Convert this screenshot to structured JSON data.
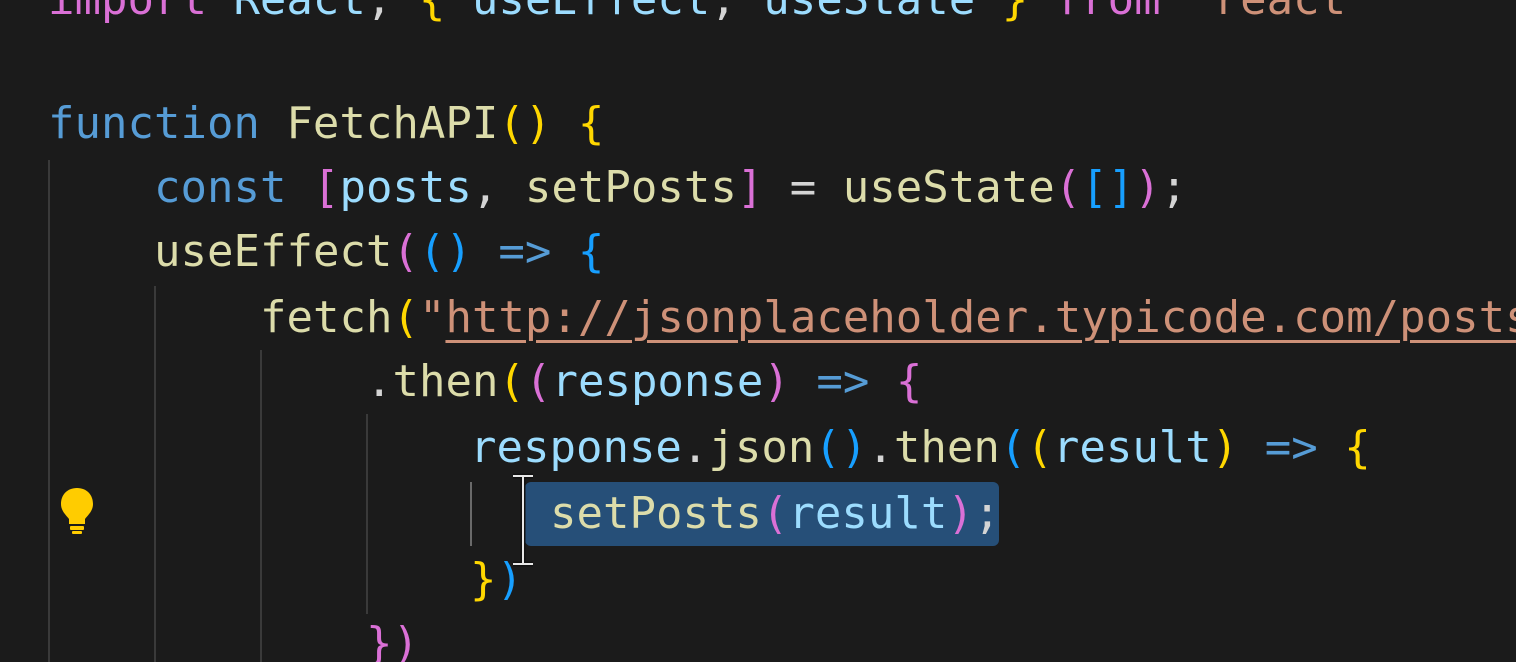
{
  "editor": {
    "theme": {
      "background": "#1b1b1b",
      "keyword": "#569cd6",
      "function": "#dcdcaa",
      "variable": "#9cdcfe",
      "string": "#ce9178",
      "bracket_level_1": "#ffd700",
      "bracket_level_2": "#da70d6",
      "bracket_level_3": "#179fff",
      "selection": "#264f78",
      "lightbulb": "#ffcc00"
    },
    "lines": [
      {
        "tokens": [
          {
            "t": "import",
            "c": "b2"
          },
          {
            "t": " React",
            "c": "var"
          },
          {
            "t": ", ",
            "c": "op"
          },
          {
            "t": "{",
            "c": "b1"
          },
          {
            "t": " useEffect",
            "c": "var"
          },
          {
            "t": ", ",
            "c": "op"
          },
          {
            "t": "useState",
            "c": "var"
          },
          {
            "t": " }",
            "c": "b1"
          },
          {
            "t": " from ",
            "c": "b2"
          },
          {
            "t": "\"react\"",
            "c": "str"
          }
        ]
      },
      {
        "tokens": []
      },
      {
        "tokens": [
          {
            "t": "function",
            "c": "kw"
          },
          {
            "t": " ",
            "c": "op"
          },
          {
            "t": "FetchAPI",
            "c": "fn"
          },
          {
            "t": "()",
            "c": "b1"
          },
          {
            "t": " ",
            "c": "op"
          },
          {
            "t": "{",
            "c": "b1"
          }
        ]
      },
      {
        "tokens": [
          {
            "t": "const",
            "c": "kw"
          },
          {
            "t": " ",
            "c": "op"
          },
          {
            "t": "[",
            "c": "b2"
          },
          {
            "t": "posts",
            "c": "var"
          },
          {
            "t": ", ",
            "c": "op"
          },
          {
            "t": "setPosts",
            "c": "fn"
          },
          {
            "t": "]",
            "c": "b2"
          },
          {
            "t": " = ",
            "c": "op"
          },
          {
            "t": "useState",
            "c": "fn"
          },
          {
            "t": "(",
            "c": "b2"
          },
          {
            "t": "[]",
            "c": "b3"
          },
          {
            "t": ")",
            "c": "b2"
          },
          {
            "t": ";",
            "c": "op"
          }
        ]
      },
      {
        "tokens": [
          {
            "t": "useEffect",
            "c": "fn"
          },
          {
            "t": "(",
            "c": "b2"
          },
          {
            "t": "()",
            "c": "b3"
          },
          {
            "t": " ",
            "c": "op"
          },
          {
            "t": "=>",
            "c": "kw"
          },
          {
            "t": " ",
            "c": "op"
          },
          {
            "t": "{",
            "c": "b3"
          }
        ]
      },
      {
        "tokens": [
          {
            "t": "fetch",
            "c": "fn"
          },
          {
            "t": "(",
            "c": "b1"
          },
          {
            "t": "\"",
            "c": "str"
          },
          {
            "t": "http://jsonplaceholder.typicode.com/posts",
            "c": "url"
          }
        ]
      },
      {
        "tokens": [
          {
            "t": ".",
            "c": "op"
          },
          {
            "t": "then",
            "c": "fn"
          },
          {
            "t": "(",
            "c": "b1"
          },
          {
            "t": "(",
            "c": "b2"
          },
          {
            "t": "response",
            "c": "var"
          },
          {
            "t": ")",
            "c": "b2"
          },
          {
            "t": " ",
            "c": "op"
          },
          {
            "t": "=>",
            "c": "kw"
          },
          {
            "t": " ",
            "c": "op"
          },
          {
            "t": "{",
            "c": "b2"
          }
        ]
      },
      {
        "tokens": [
          {
            "t": "response",
            "c": "var"
          },
          {
            "t": ".",
            "c": "op"
          },
          {
            "t": "json",
            "c": "fn"
          },
          {
            "t": "()",
            "c": "b3"
          },
          {
            "t": ".",
            "c": "op"
          },
          {
            "t": "then",
            "c": "fn"
          },
          {
            "t": "(",
            "c": "b3"
          },
          {
            "t": "(",
            "c": "b1"
          },
          {
            "t": "result",
            "c": "var"
          },
          {
            "t": ")",
            "c": "b1"
          },
          {
            "t": " ",
            "c": "op"
          },
          {
            "t": "=>",
            "c": "kw"
          },
          {
            "t": " ",
            "c": "op"
          },
          {
            "t": "{",
            "c": "b1"
          }
        ]
      },
      {
        "tokens": [
          {
            "t": "setPosts",
            "c": "fn"
          },
          {
            "t": "(",
            "c": "b2"
          },
          {
            "t": "result",
            "c": "var"
          },
          {
            "t": ")",
            "c": "b2"
          },
          {
            "t": ";",
            "c": "op"
          }
        ]
      },
      {
        "tokens": [
          {
            "t": "}",
            "c": "b1"
          },
          {
            "t": ")",
            "c": "b3"
          }
        ]
      },
      {
        "tokens": [
          {
            "t": "})",
            "c": "b2"
          }
        ]
      }
    ]
  }
}
